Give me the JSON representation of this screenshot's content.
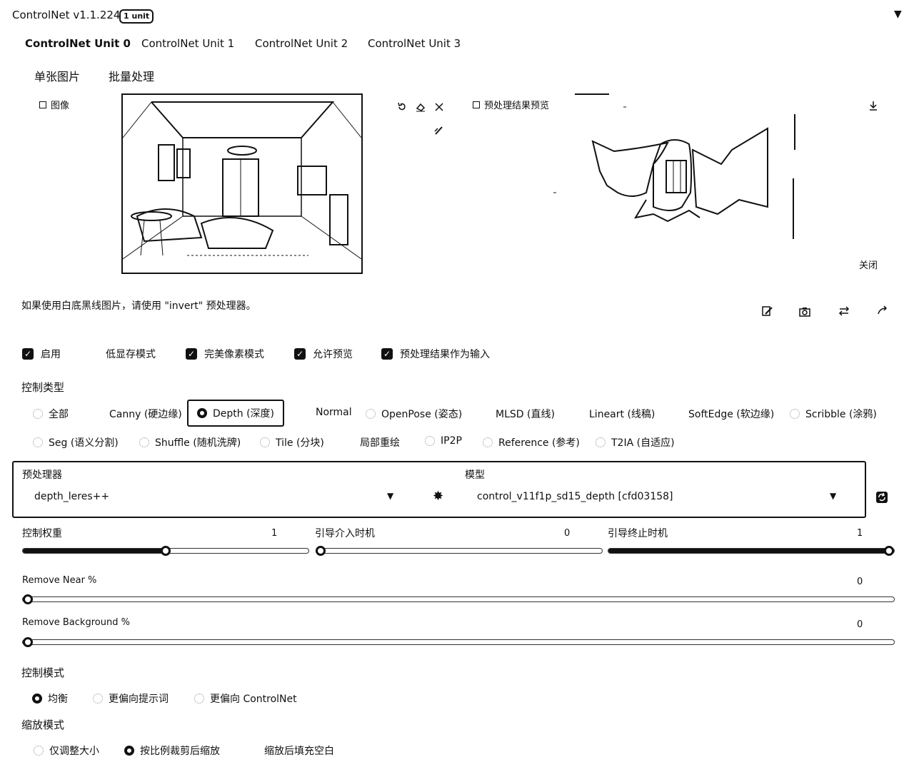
{
  "header": {
    "title": "ControlNet v1.1.224",
    "badge": "1 unit",
    "collapse_icon": "▼"
  },
  "unit_tabs": [
    "ControlNet Unit 0",
    "ControlNet Unit 1",
    "ControlNet Unit 2",
    "ControlNet Unit 3"
  ],
  "image_tabs": [
    "单张图片",
    "批量处理"
  ],
  "image_panel": {
    "label": "图像"
  },
  "preview_panel": {
    "label": "预处理结果预览",
    "close": "关闭"
  },
  "note": "如果使用白底黑线图片，请使用 \"invert\" 预处理器。",
  "checkboxes": [
    {
      "label": "启用",
      "checked": true
    },
    {
      "label": "低显存模式",
      "checked": false
    },
    {
      "label": "完美像素模式",
      "checked": true
    },
    {
      "label": "允许预览",
      "checked": true
    },
    {
      "label": "预处理结果作为输入",
      "checked": true
    }
  ],
  "control_type": {
    "heading": "控制类型",
    "row1": [
      "全部",
      "Canny (硬边缘)",
      "Depth (深度)",
      "Normal",
      "OpenPose (姿态)",
      "MLSD (直线)",
      "Lineart (线稿)",
      "SoftEdge (软边缘)",
      "Scribble (涂鸦)"
    ],
    "row2": [
      "Seg (语义分割)",
      "Shuffle (随机洗牌)",
      "Tile (分块)",
      "局部重绘",
      "IP2P",
      "Reference (参考)",
      "T2IA (自适应)"
    ],
    "selected": "Depth (深度)"
  },
  "preprocessor": {
    "label": "预处理器",
    "value": "depth_leres++"
  },
  "model": {
    "label": "模型",
    "value": "control_v11f1p_sd15_depth [cfd03158]"
  },
  "sliders": {
    "weight": {
      "label": "控制权重",
      "value": "1",
      "fraction": 0.5
    },
    "start": {
      "label": "引导介入时机",
      "value": "0",
      "fraction": 0
    },
    "end": {
      "label": "引导终止时机",
      "value": "1",
      "fraction": 1
    },
    "remove_near": {
      "label": "Remove Near %",
      "value": "0",
      "fraction": 0
    },
    "remove_bg": {
      "label": "Remove Background %",
      "value": "0",
      "fraction": 0
    }
  },
  "control_mode": {
    "heading": "控制模式",
    "options": [
      "均衡",
      "更偏向提示词",
      "更偏向 ControlNet"
    ],
    "selected": "均衡"
  },
  "resize_mode": {
    "heading": "缩放模式",
    "options": [
      "仅调整大小",
      "按比例裁剪后缩放",
      "缩放后填充空白"
    ],
    "selected": "按比例裁剪后缩放"
  },
  "icons": [
    "undo-icon",
    "eraser-icon",
    "close-icon",
    "brush-icon",
    "download-icon",
    "edit-icon",
    "camera-icon",
    "swap-icon",
    "send-icon",
    "explosion-icon",
    "refresh-icon"
  ]
}
